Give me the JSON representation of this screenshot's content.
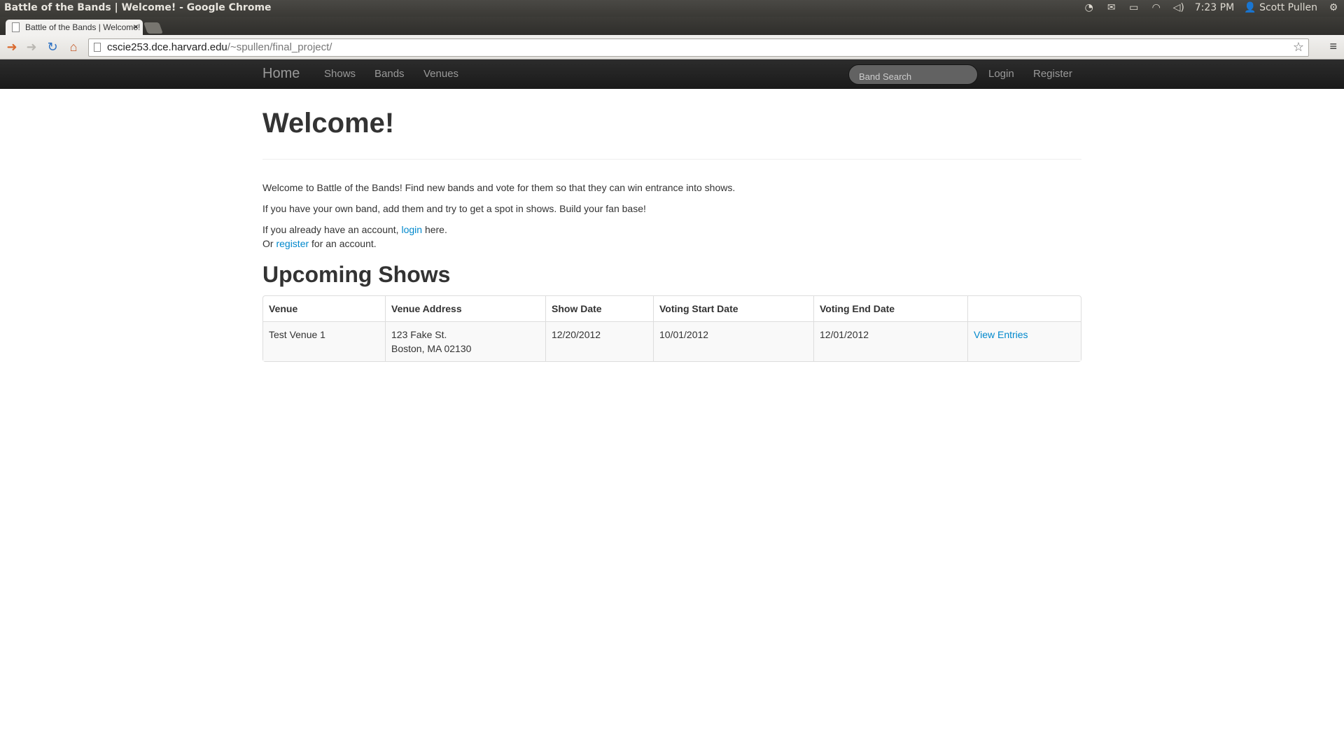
{
  "os": {
    "window_title": "Battle of the Bands | Welcome! - Google Chrome",
    "time": "7:23 PM",
    "user": "Scott Pullen"
  },
  "browser": {
    "tab_title": "Battle of the Bands | Welcome!",
    "url_host": "cscie253.dce.harvard.edu",
    "url_path": "/~spullen/final_project/"
  },
  "navbar": {
    "brand": "Home",
    "links": [
      "Shows",
      "Bands",
      "Venues"
    ],
    "search_placeholder": "Band Search",
    "login": "Login",
    "register": "Register"
  },
  "page": {
    "title": "Welcome!",
    "intro1": "Welcome to Battle of the Bands! Find new bands and vote for them so that they can win entrance into shows.",
    "intro2": "If you have your own band, add them and try to get a spot in shows. Build your fan base!",
    "account_prefix": "If you already have an account, ",
    "account_link": "login",
    "account_suffix": " here.",
    "register_prefix": "Or ",
    "register_link": "register",
    "register_suffix": " for an account.",
    "shows_heading": "Upcoming Shows"
  },
  "shows_table": {
    "headers": [
      "Venue",
      "Venue Address",
      "Show Date",
      "Voting Start Date",
      "Voting End Date",
      ""
    ],
    "rows": [
      {
        "venue": "Test Venue 1",
        "address_line1": "123 Fake St.",
        "address_line2": "Boston, MA 02130",
        "show_date": "12/20/2012",
        "voting_start": "10/01/2012",
        "voting_end": "12/01/2012",
        "action": "View Entries"
      }
    ]
  }
}
